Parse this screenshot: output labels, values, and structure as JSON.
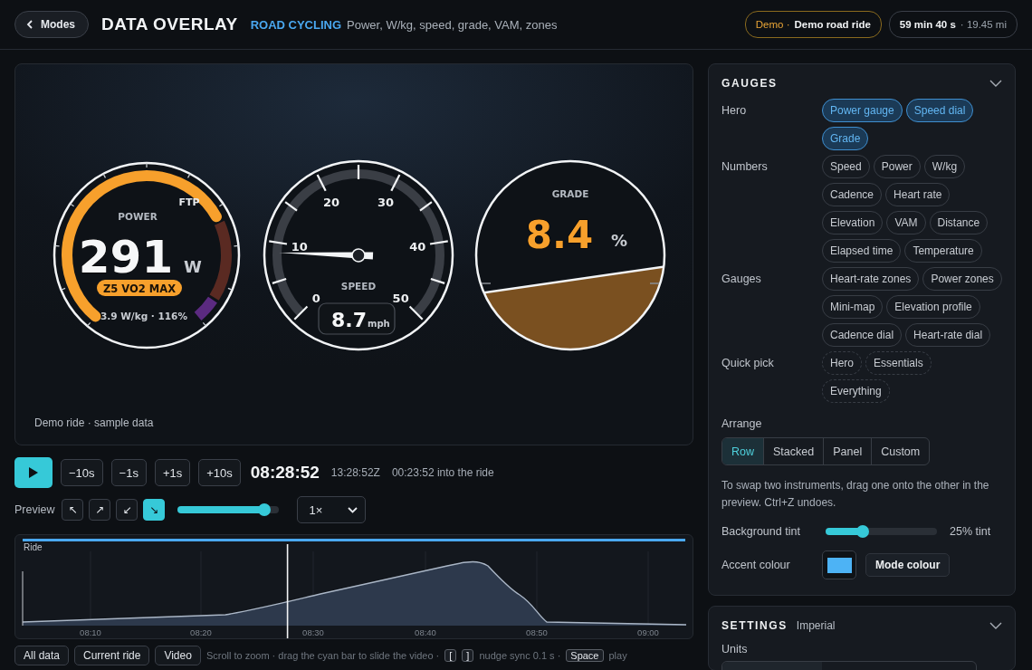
{
  "header": {
    "back_button": "Modes",
    "title": "DATA OVERLAY",
    "mode": "ROAD CYCLING",
    "subtitle": "Power, W/kg, speed, grade, VAM, zones",
    "demo_badge": {
      "label": "Demo ·",
      "ride": "Demo road ride"
    },
    "duration_badge": {
      "duration": "59 min 40 s",
      "distance": "· 19.45 mi"
    }
  },
  "preview": {
    "power": {
      "label": "POWER",
      "ftp_label": "FTP",
      "value": "291",
      "unit": "W",
      "zone": "Z5 VO2 MAX",
      "detail": "3.9 W/kg · 116%"
    },
    "speed": {
      "label": "SPEED",
      "ticks": [
        "0",
        "10",
        "20",
        "30",
        "40",
        "50"
      ],
      "value": "8.7",
      "unit": "mph"
    },
    "grade": {
      "label": "GRADE",
      "value": "8.4",
      "unit": "%"
    },
    "caption": "Demo ride · sample data"
  },
  "transport": {
    "steps": [
      "−10s",
      "−1s",
      "+1s",
      "+10s"
    ],
    "clock": "08:28:52",
    "utc": "13:28:52Z",
    "elapsed": "00:23:52 into the ride"
  },
  "preview_controls": {
    "label": "Preview",
    "corners": [
      {
        "glyph": "↖",
        "selected": false
      },
      {
        "glyph": "↗",
        "selected": false
      },
      {
        "glyph": "↙",
        "selected": false
      },
      {
        "glyph": "↘",
        "selected": true
      }
    ],
    "size": {
      "level": 0.85
    },
    "speed": "1×"
  },
  "timeline": {
    "label": "Ride",
    "x_ticks": [
      "08:10",
      "08:20",
      "08:30",
      "08:40",
      "08:50",
      "09:00"
    ],
    "playhead": {
      "level": 0.4
    }
  },
  "filters": [
    "All data",
    "Current ride",
    "Video"
  ],
  "hint": [
    {
      "kind": "text",
      "text": "Scroll to zoom · drag the cyan bar to slide the video ·"
    },
    {
      "kind": "key",
      "text": "["
    },
    {
      "kind": "key",
      "text": "]"
    },
    {
      "kind": "text",
      "text": "nudge sync 0.1 s ·"
    },
    {
      "kind": "key",
      "text": "Space"
    },
    {
      "kind": "text",
      "text": "play"
    }
  ],
  "gauges_panel": {
    "title": "GAUGES",
    "groups": [
      {
        "label": "Hero",
        "kind": "toggle",
        "chips": [
          {
            "label": "Power gauge",
            "selected": true
          },
          {
            "label": "Speed dial",
            "selected": true
          },
          {
            "label": "Grade",
            "selected": true
          }
        ]
      },
      {
        "label": "Numbers",
        "kind": "toggle",
        "chips": [
          {
            "label": "Speed",
            "selected": false
          },
          {
            "label": "Power",
            "selected": false
          },
          {
            "label": "W/kg",
            "selected": false
          },
          {
            "label": "Cadence",
            "selected": false
          },
          {
            "label": "Heart rate",
            "selected": false
          },
          {
            "label": "Elevation",
            "selected": false
          },
          {
            "label": "VAM",
            "selected": false
          },
          {
            "label": "Distance",
            "selected": false
          },
          {
            "label": "Elapsed time",
            "selected": false
          },
          {
            "label": "Temperature",
            "selected": false
          }
        ]
      },
      {
        "label": "Gauges",
        "kind": "toggle",
        "chips": [
          {
            "label": "Heart-rate zones",
            "selected": false
          },
          {
            "label": "Power zones",
            "selected": false
          },
          {
            "label": "Mini-map",
            "selected": false
          },
          {
            "label": "Elevation profile",
            "selected": false
          },
          {
            "label": "Cadence dial",
            "selected": false
          },
          {
            "label": "Heart-rate dial",
            "selected": false
          }
        ]
      },
      {
        "label": "Quick pick",
        "kind": "preset",
        "chips": [
          {
            "label": "Hero"
          },
          {
            "label": "Essentials"
          },
          {
            "label": "Everything"
          }
        ]
      }
    ],
    "arrange": {
      "label": "Arrange",
      "options": [
        {
          "label": "Row",
          "selected": true
        },
        {
          "label": "Stacked",
          "selected": false
        },
        {
          "label": "Panel",
          "selected": false
        },
        {
          "label": "Custom",
          "selected": false
        }
      ]
    },
    "note": "To swap two instruments, drag one onto the other in the preview. Ctrl+Z undoes.",
    "tint": {
      "label": "Background tint",
      "level": 0.33,
      "reading": "25% tint"
    },
    "accent": {
      "label": "Accent colour",
      "color": "#4db3f5",
      "button": "Mode colour"
    }
  },
  "settings_panel": {
    "title": "SETTINGS",
    "subtitle": "Imperial",
    "units_label": "Units"
  }
}
